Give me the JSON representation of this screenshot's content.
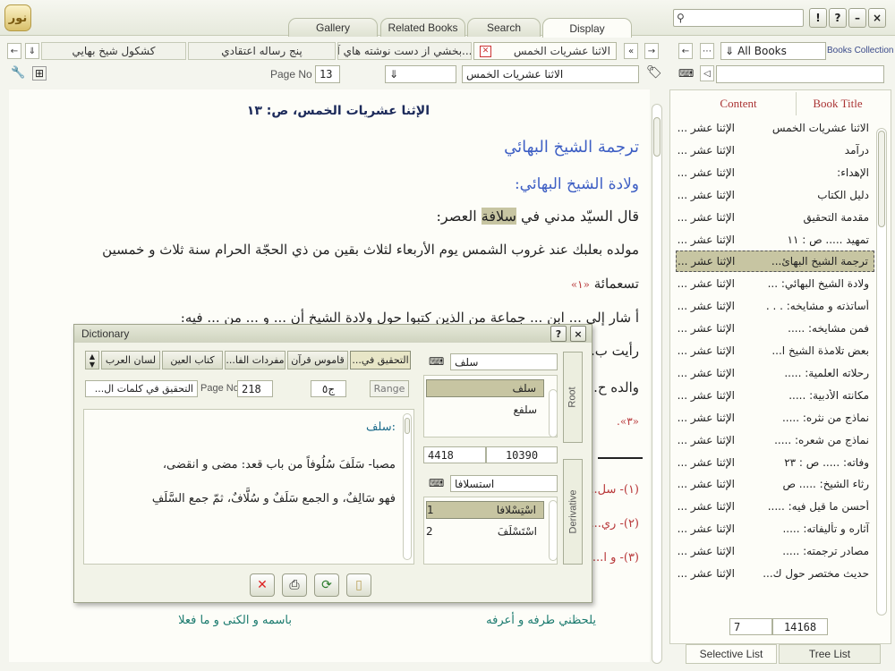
{
  "app": {
    "logo_text": "نور"
  },
  "tabs": [
    "Gallery",
    "Related Books",
    "Search",
    "Display"
  ],
  "active_tab": "Display",
  "window_controls": {
    "help1": "!",
    "help2": "?",
    "minimize": "–",
    "close": "×"
  },
  "search_top": {
    "value": ""
  },
  "doc_tabs": [
    {
      "label": "الاثنا عشريات الخمس",
      "active": true
    },
    {
      "label": "بخشي از دست نوشته هاي آ...",
      "active": false
    },
    {
      "label": "پنج رساله اعتقادي",
      "active": false
    },
    {
      "label": "كشكول شيخ بهايي",
      "active": false
    }
  ],
  "toolbar": {
    "page_label": "Page No",
    "page_value": "13",
    "book_select": "الاثنا عشريات الخمس"
  },
  "document": {
    "header": "الإثنا عشريات الخمس، ص: ١٣",
    "title1": "ترجمة الشيخ البهائي",
    "title2": "ولادة الشيخ البهائي:",
    "line1_pre": "قال السيّد مدني في ",
    "line1_hl": "سلافة",
    "line1_post": " العصر:",
    "line2": "مولده بعلبك عند غروب الشمس يوم الأربعاء لثلاث بقين من ذي الحجّة الحرام سنة ثلاث و خمسين",
    "line3": "تسعمائة",
    "fn1": "«١»",
    "line4": "أ شار إلى ... ابن ... جماعة من الذين كتبوا حول ولادة الشيخ أن ... و ... من ... فيه:",
    "line5": "رأيت ب...",
    "line6": "والده ح... السّلام",
    "fn3": "«٣».",
    "foot1": "(١)- سل...",
    "foot2": "(٢)- ري...",
    "foot3": "(٣)- و ا...",
    "bottom_right": "يلحظني طرفه و أعرفه",
    "bottom_left": "باسمه و الكنى و ما فعلا"
  },
  "right_panel": {
    "books_filter": "All Books",
    "collection_label": "Books Collection",
    "col_content": "Content",
    "col_title": "Book Title",
    "rows": [
      {
        "title": "الإثنا عشر ...",
        "content": "الاثنا عشريات الخمس"
      },
      {
        "title": "الإثنا عشر ...",
        "content": "درآمد"
      },
      {
        "title": "الإثنا عشر ...",
        "content": "الإهداء:"
      },
      {
        "title": "الإثنا عشر ...",
        "content": "دليل الكتاب"
      },
      {
        "title": "الإثنا عشر ...",
        "content": "مقدمة التحقيق"
      },
      {
        "title": "الإثنا عشر ...",
        "content": "تمهيد ..... ص : ١١"
      },
      {
        "title": "الإثنا عشر ...",
        "content": "ترجمة الشيخ البهائ..."
      },
      {
        "title": "الإثنا عشر ...",
        "content": "ولادة الشيخ البهائي: ..."
      },
      {
        "title": "الإثنا عشر ...",
        "content": "أساتذته و مشايخه: . . ."
      },
      {
        "title": "الإثنا عشر ...",
        "content": "فمن مشايخه: ....."
      },
      {
        "title": "الإثنا عشر ...",
        "content": "بعض تلامذة الشيخ ا..."
      },
      {
        "title": "الإثنا عشر ...",
        "content": "رحلاته العلمية: ....."
      },
      {
        "title": "الإثنا عشر ...",
        "content": "مكانته الأدبية: ....."
      },
      {
        "title": "الإثنا عشر ...",
        "content": "نماذج من نثره: ....."
      },
      {
        "title": "الإثنا عشر ...",
        "content": "نماذج من شعره: ....."
      },
      {
        "title": "الإثنا عشر ...",
        "content": "وفاته: ..... ص : ٢٣"
      },
      {
        "title": "الإثنا عشر ...",
        "content": "رثاء الشيخ: ..... ص"
      },
      {
        "title": "الإثنا عشر ...",
        "content": "أحسن ما قيل فيه: ....."
      },
      {
        "title": "الإثنا عشر ...",
        "content": "آثاره و تأليفاته: ....."
      },
      {
        "title": "الإثنا عشر ...",
        "content": "مصادر ترجمته: ....."
      },
      {
        "title": "الإثنا عشر ...",
        "content": "حديث مختصر حول ك..."
      }
    ],
    "selected_index": 6,
    "pager_current": "7",
    "pager_total": "14168",
    "bottom_tabs": [
      "Selective List",
      "Tree List"
    ]
  },
  "dictionary": {
    "title": "Dictionary",
    "help": "?",
    "close": "×",
    "dict_tabs": [
      "التحقيق في...",
      "قاموس قرآن",
      "مفردات الفا...",
      "كتاب العين",
      "لسان العرب"
    ],
    "book_select": "التحقيق في كلمات ال...",
    "page_label": "Page No",
    "page_value": "218",
    "volume": "ج٥",
    "range_label": "Range",
    "root_input": "سلف",
    "root_tab": "Root",
    "root_items": [
      "سلف",
      "سلفع"
    ],
    "count_left": "4418",
    "count_right": "10390",
    "derivative_input": "استسلافا",
    "derivative_tab": "Derivative",
    "derivative_items": [
      {
        "text": "اسْتِسْلافا",
        "num": "1"
      },
      {
        "text": "اسْتَسْلَفَ",
        "num": "2"
      }
    ],
    "entry_head": "سلف:",
    "entry_line1": "مصبا- سَلَفَ سُلُوفاً من باب قعد: مضى و انقضى،",
    "entry_line2": "فهو سَالِفٌ، و الجمع سَلَفٌ و سُلَّافٌ، ثمّ جمع السَّلَفِ"
  }
}
